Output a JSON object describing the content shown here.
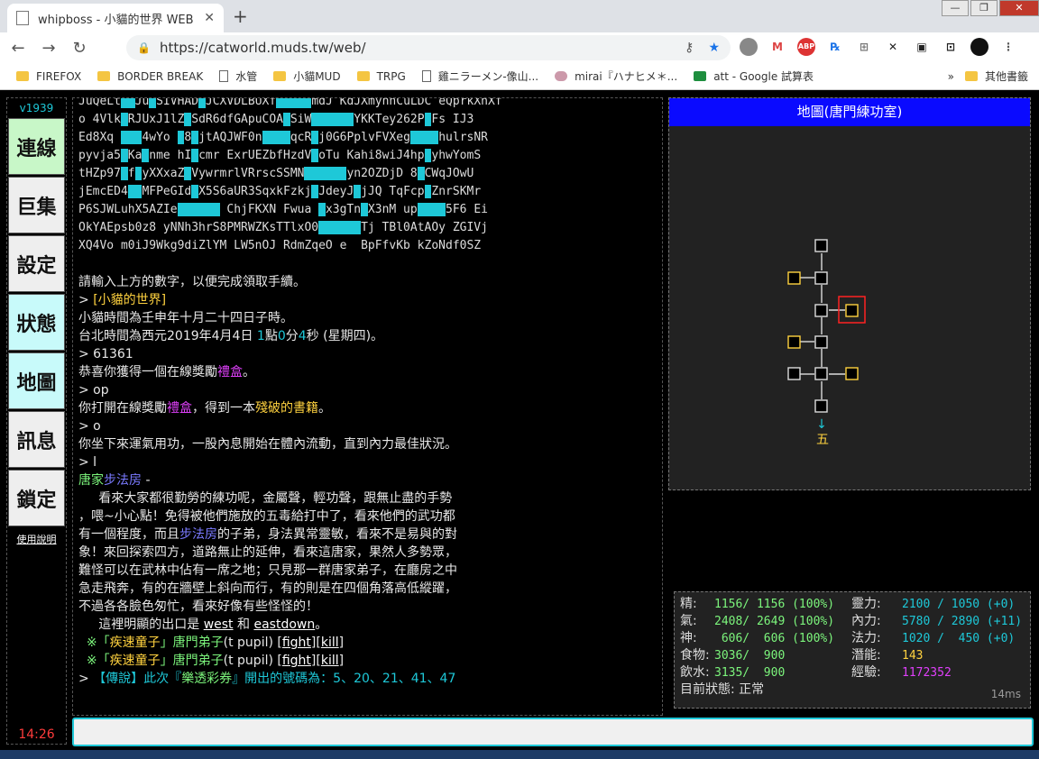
{
  "browser": {
    "tab_title": "whipboss - 小貓的世界 WEB",
    "tab_close": "✕",
    "new_tab": "+",
    "url": "https://catworld.muds.tw/web/",
    "back": "←",
    "forward": "→",
    "reload": "↻",
    "extensions": [
      "M",
      "ABP",
      "℞",
      "⊞",
      "✕",
      "▣",
      "⊡"
    ],
    "window_controls": [
      "—",
      "❐",
      "✕"
    ],
    "bookmarks": [
      {
        "label": "FIREFOX",
        "icon": "folder"
      },
      {
        "label": "BORDER BREAK",
        "icon": "folder"
      },
      {
        "label": "水管",
        "icon": "page"
      },
      {
        "label": "小貓MUD",
        "icon": "folder"
      },
      {
        "label": "TRPG",
        "icon": "folder"
      },
      {
        "label": "雞ニラーメン-像山...",
        "icon": "page"
      },
      {
        "label": "mirai『ハナヒメ＊...",
        "icon": "avatar"
      },
      {
        "label": "att - Google 試算表",
        "icon": "sheet"
      }
    ],
    "more_bookmarks": "»",
    "other_bookmarks": "其他書籤"
  },
  "sidebar": {
    "version": "v1939",
    "items": [
      {
        "label": "連線",
        "style": "green"
      },
      {
        "label": "巨集",
        "style": "gray"
      },
      {
        "label": "設定",
        "style": "gray"
      },
      {
        "label": "狀態",
        "style": "cyan"
      },
      {
        "label": "地圖",
        "style": "cyan"
      },
      {
        "label": "訊息",
        "style": "gray"
      },
      {
        "label": "鎖定",
        "style": "gray"
      }
    ],
    "help": "使用說明",
    "clock": "14:26"
  },
  "console": {
    "captcha_rows": [
      [
        [
          "t",
          "JuQeLt"
        ],
        [
          "h",
          "  "
        ],
        [
          "t",
          "Ju"
        ],
        [
          "h",
          " "
        ],
        [
          "t",
          "SIVHAD"
        ],
        [
          "h",
          " "
        ],
        [
          "t",
          "JCXVDLBUXf"
        ],
        [
          "h",
          "     "
        ],
        [
          "t",
          "mdJ KdJXmynnCuLDC eQprkXnXf"
        ]
      ],
      [
        [
          "t",
          "o 4Vlk"
        ],
        [
          "h",
          " "
        ],
        [
          "t",
          "RJUxJ1lZ"
        ],
        [
          "h",
          " "
        ],
        [
          "t",
          "SdR6dfGApuCOA"
        ],
        [
          "h",
          " "
        ],
        [
          "t",
          "SiW"
        ],
        [
          "h",
          "      "
        ],
        [
          "t",
          "YKKTey262P"
        ],
        [
          "h",
          " "
        ],
        [
          "t",
          "Fs IJ3"
        ]
      ],
      [
        [
          "t",
          "Ed8Xq "
        ],
        [
          "h",
          "   "
        ],
        [
          "t",
          "4wYo "
        ],
        [
          "h",
          " "
        ],
        [
          "t",
          "8"
        ],
        [
          "h",
          " "
        ],
        [
          "t",
          "jtAQJWF0n"
        ],
        [
          "h",
          "    "
        ],
        [
          "t",
          "qcR"
        ],
        [
          "h",
          " "
        ],
        [
          "t",
          "j0G6PplvFVXeg"
        ],
        [
          "h",
          "    "
        ],
        [
          "t",
          "hulrsNR"
        ]
      ],
      [
        [
          "t",
          "pyvja5"
        ],
        [
          "h",
          " "
        ],
        [
          "t",
          "Ka"
        ],
        [
          "h",
          " "
        ],
        [
          "t",
          "nme hI"
        ],
        [
          "h",
          " "
        ],
        [
          "t",
          "cmr ExrUEZbfHzdV"
        ],
        [
          "h",
          " "
        ],
        [
          "t",
          "oTu Kahi8wiJ4hp"
        ],
        [
          "h",
          " "
        ],
        [
          "t",
          "yhwYomS"
        ]
      ],
      [
        [
          "t",
          "tHZp97"
        ],
        [
          "h",
          " "
        ],
        [
          "t",
          "f"
        ],
        [
          "h",
          " "
        ],
        [
          "t",
          "yXXxaZ"
        ],
        [
          "h",
          " "
        ],
        [
          "t",
          "VywrmrlVRrscSSMN"
        ],
        [
          "h",
          "      "
        ],
        [
          "t",
          "yn2OZDjD 8"
        ],
        [
          "h",
          " "
        ],
        [
          "t",
          "CWqJOwU"
        ]
      ],
      [
        [
          "t",
          "jEmcED4"
        ],
        [
          "h",
          "  "
        ],
        [
          "t",
          "MFPeGId"
        ],
        [
          "h",
          " "
        ],
        [
          "t",
          "X5S6aUR3SqxkFzkj"
        ],
        [
          "h",
          " "
        ],
        [
          "t",
          "JdeyJ"
        ],
        [
          "h",
          " "
        ],
        [
          "t",
          "jJQ TqFcp"
        ],
        [
          "h",
          " "
        ],
        [
          "t",
          "ZnrSKMr"
        ]
      ],
      [
        [
          "t",
          "P6SJWLuhX5AZIe"
        ],
        [
          "h",
          "      "
        ],
        [
          "t",
          " ChjFKXN Fwua "
        ],
        [
          "h",
          " "
        ],
        [
          "t",
          "x3gTn"
        ],
        [
          "h",
          " "
        ],
        [
          "t",
          "X3nM up"
        ],
        [
          "h",
          "    "
        ],
        [
          "t",
          "5F6 Ei"
        ]
      ],
      [
        [
          "t",
          "OkYAEpsb0z8 yNNh3hrS8PMRWZKsTTlxO0"
        ],
        [
          "h",
          "      "
        ],
        [
          "t",
          "Tj TBl0AtAOy ZGIVj"
        ]
      ],
      [
        [
          "t",
          "XQ4Vo m0iJ9Wkg9diZlYM LW5nOJ RdmZqeO e  BpFfvKb kZoNdf0SZ"
        ]
      ]
    ],
    "lines": [
      [
        [
          "w",
          ""
        ]
      ],
      [
        [
          "w",
          "請輸入上方的數字，以便完成領取手續。"
        ]
      ],
      [
        [
          "w",
          "> "
        ],
        [
          "y",
          "[小貓的世界]"
        ]
      ],
      [
        [
          "w",
          "小貓時間為壬申年十月二十四日子時。"
        ]
      ],
      [
        [
          "w",
          "台北時間為西元2019年4月4日 "
        ],
        [
          "c",
          "1"
        ],
        [
          "w",
          "點"
        ],
        [
          "c",
          "0"
        ],
        [
          "w",
          "分"
        ],
        [
          "c",
          "4"
        ],
        [
          "w",
          "秒 (星期四)。"
        ]
      ],
      [
        [
          "w",
          "> 61361"
        ]
      ],
      [
        [
          "w",
          "恭喜你獲得一個在線獎勵"
        ],
        [
          "m",
          "禮盒"
        ],
        [
          "w",
          "。"
        ]
      ],
      [
        [
          "w",
          "> op"
        ]
      ],
      [
        [
          "w",
          "你打開在線獎勵"
        ],
        [
          "m",
          "禮盒"
        ],
        [
          "w",
          "，得到一本"
        ],
        [
          "y",
          "殘破的書籍"
        ],
        [
          "w",
          "。"
        ]
      ],
      [
        [
          "w",
          "> o"
        ]
      ],
      [
        [
          "w",
          "你坐下來運氣用功，一股內息開始在體內流動，直到內力最佳狀況。"
        ]
      ],
      [
        [
          "w",
          "> l"
        ]
      ],
      [
        [
          "g",
          "唐家"
        ],
        [
          "b",
          "步法房"
        ],
        [
          "w",
          " -"
        ]
      ],
      [
        [
          "w",
          "     看來大家都很勤勞的練功呢，金屬聲，輕功聲，跟無止盡的手勢"
        ]
      ],
      [
        [
          "w",
          "，喂~小心點！免得被他們施放的五毒給打中了，看來他們的武功都"
        ]
      ],
      [
        [
          "w",
          "有一個程度，而且"
        ],
        [
          "b",
          "步法房"
        ],
        [
          "w",
          "的子弟，身法異常靈敏，看來不是易與的對"
        ]
      ],
      [
        [
          "w",
          "象！來回探索四方，道路無止的延伸，看來這唐家，果然人多勢眾，"
        ]
      ],
      [
        [
          "w",
          "難怪可以在武林中佔有一席之地；只見那一群唐家弟子，在廳房之中"
        ]
      ],
      [
        [
          "w",
          "急走飛奔，有的在牆壁上斜向而行，有的則是在四個角落高低縱躍，"
        ]
      ],
      [
        [
          "w",
          "不過各各臉色匆忙，看來好像有些怪怪的！"
        ]
      ],
      [
        [
          "w",
          "     這裡明顯的出口是 "
        ],
        [
          "u",
          "west"
        ],
        [
          "w",
          " 和 "
        ],
        [
          "u",
          "eastdown"
        ],
        [
          "w",
          "。"
        ]
      ],
      [
        [
          "w",
          "  "
        ],
        [
          "g",
          "※「"
        ],
        [
          "y",
          "疾速童子"
        ],
        [
          "g",
          "」唐門弟子"
        ],
        [
          "w",
          "(t pupil) ["
        ],
        [
          "u",
          "fight"
        ],
        [
          "w",
          "]["
        ],
        [
          "u",
          "kill"
        ],
        [
          "w",
          "]"
        ]
      ],
      [
        [
          "w",
          "  "
        ],
        [
          "g",
          "※「"
        ],
        [
          "y",
          "疾速童子"
        ],
        [
          "g",
          "」唐門弟子"
        ],
        [
          "w",
          "(t pupil) ["
        ],
        [
          "u",
          "fight"
        ],
        [
          "w",
          "]["
        ],
        [
          "u",
          "kill"
        ],
        [
          "w",
          "]"
        ]
      ],
      [
        [
          "w",
          "> "
        ],
        [
          "c",
          "【傳說】此次『"
        ],
        [
          "g",
          "樂透彩券"
        ],
        [
          "c",
          "』開出的號碼為：5、20、21、41、47"
        ]
      ]
    ]
  },
  "map": {
    "title": "地圖(唐門練功室)",
    "down_arrow": "↓",
    "exit_label": "五"
  },
  "stats": {
    "rows": [
      {
        "l1": "精:",
        "v1": "1156/ 1156 (100%)",
        "l2": "靈力:",
        "v2": "2100 / 1050 (+0)",
        "c2": "#1ec8d8"
      },
      {
        "l1": "氣:",
        "v1": "2408/ 2649 (100%)",
        "l2": "內力:",
        "v2": "5780 / 2890 (+11)",
        "c2": "#1ec8d8"
      },
      {
        "l1": "神:",
        "v1": " 606/  606 (100%)",
        "l2": "法力:",
        "v2": "1020 /  450 (+0)",
        "c2": "#1ec8d8"
      },
      {
        "l1": "食物:",
        "v1": "3036/  900",
        "l2": "潛能:",
        "v2": "143",
        "c2": "#ffd23f"
      },
      {
        "l1": "飲水:",
        "v1": "3135/  900",
        "l2": "經驗:",
        "v2": "1172352",
        "c2": "#e040fb"
      }
    ],
    "state_label": "目前狀態: 正常",
    "ping": "14ms"
  },
  "colors": {
    "accent": "#1ec8d8",
    "map_title_bg": "#0a0aff",
    "clock": "#ff3b3b"
  },
  "input": {
    "value": ""
  }
}
